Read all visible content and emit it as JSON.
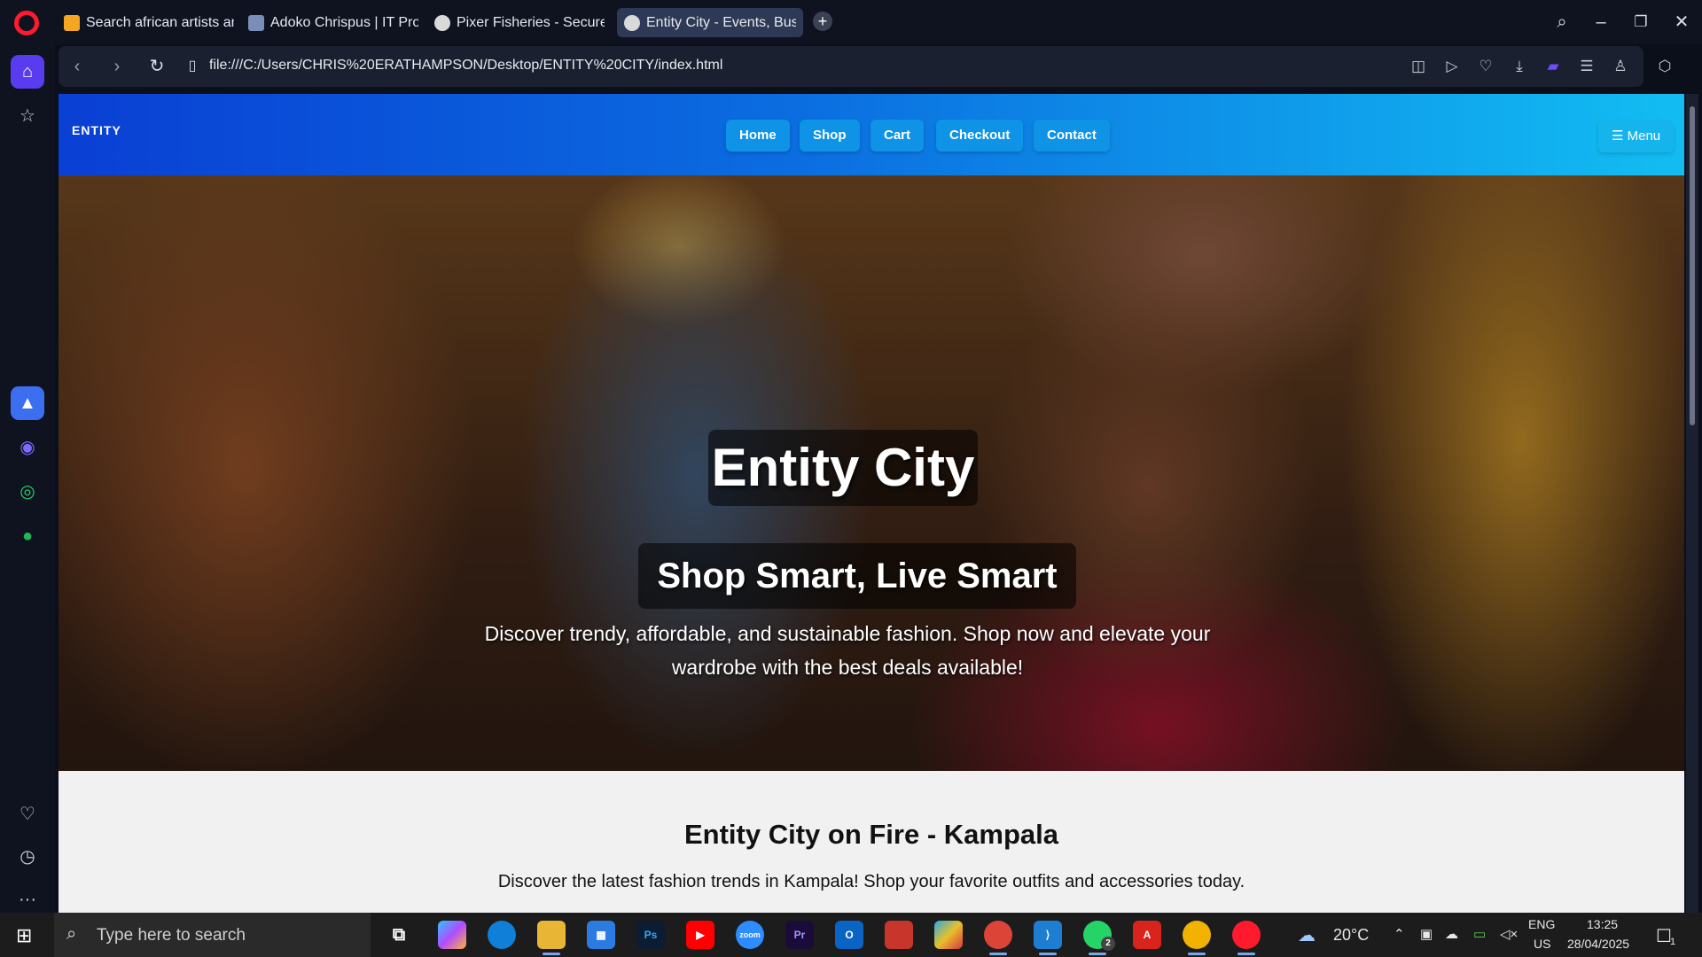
{
  "browser": {
    "tabs": [
      {
        "label": "Search african artists and s",
        "favicon_color": "#f5a623",
        "active": false
      },
      {
        "label": "Adoko Chrispus | IT Profes",
        "favicon_color": "#7a8fb8",
        "active": false
      },
      {
        "label": "Pixer Fisheries - Secure Ac",
        "favicon_color": "#d9d9d9",
        "active": false
      },
      {
        "label": "Entity City - Events, Busine",
        "favicon_color": "#d9d9d9",
        "active": true
      }
    ],
    "url": "file:///C:/Users/CHRIS%20ERATHAMPSON/Desktop/ENTITY%20CITY/index.html",
    "accent": "#ff1b2d"
  },
  "site": {
    "brand": "ENTITY",
    "nav": [
      "Home",
      "Shop",
      "Cart",
      "Checkout",
      "Contact"
    ],
    "menu_label": "☰ Menu",
    "hero": {
      "title": "Entity City",
      "subtitle": "Shop Smart, Live Smart",
      "description": "Discover trendy, affordable, and sustainable fashion. Shop now and elevate your wardrobe with the best deals available!"
    },
    "section": {
      "title": "Entity City on Fire - Kampala",
      "description": "Discover the latest fashion trends in Kampala! Shop your favorite outfits and accessories today."
    },
    "header_gradient": [
      "#0a3fd4",
      "#12bdf2"
    ]
  },
  "taskbar": {
    "search_placeholder": "Type here to search",
    "weather": "20°C",
    "language": "ENG",
    "region": "US",
    "time": "13:25",
    "date": "28/04/2025",
    "whatsapp_badge": "2",
    "notification_count": "1"
  }
}
